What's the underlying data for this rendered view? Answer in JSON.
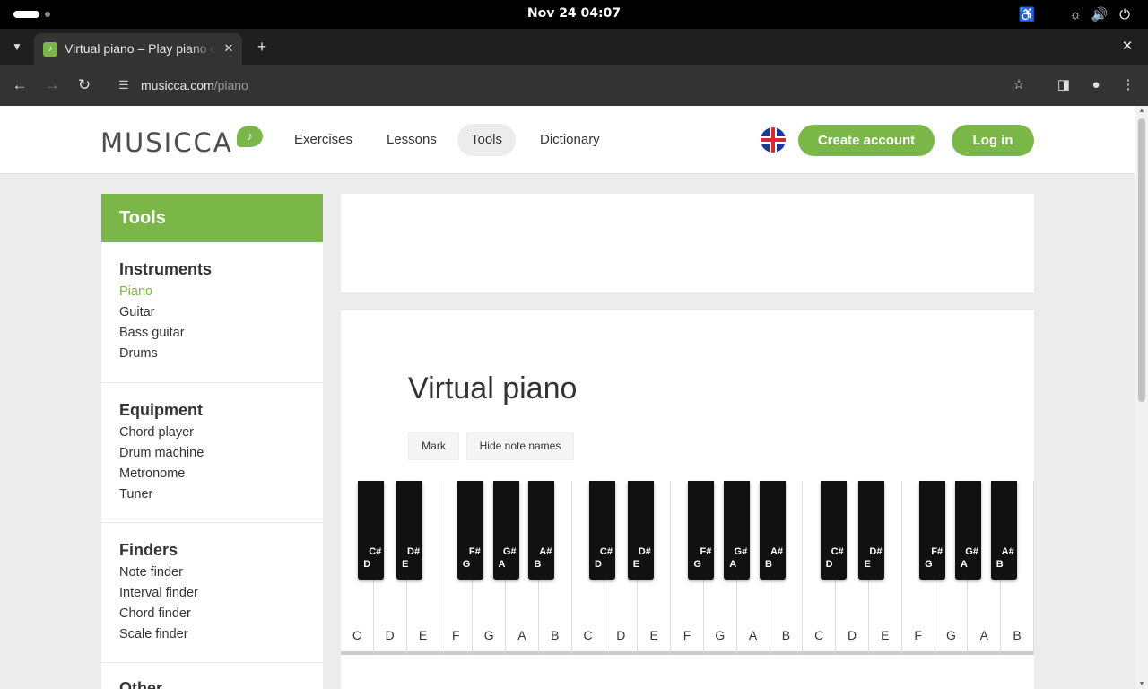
{
  "os": {
    "clock": "Nov 24  04:07"
  },
  "browser": {
    "tab_title": "Virtual piano – Play piano online",
    "url_host": "musicca.com",
    "url_path": "/piano"
  },
  "site": {
    "logo": "MUSICCA",
    "nav": [
      "Exercises",
      "Lessons",
      "Tools",
      "Dictionary"
    ],
    "active_nav": "Tools",
    "create_account": "Create account",
    "login": "Log in"
  },
  "sidebar": {
    "heading": "Tools",
    "sections": [
      {
        "title": "Instruments",
        "items": [
          "Piano",
          "Guitar",
          "Bass guitar",
          "Drums"
        ]
      },
      {
        "title": "Equipment",
        "items": [
          "Chord player",
          "Drum machine",
          "Metronome",
          "Tuner"
        ]
      },
      {
        "title": "Finders",
        "items": [
          "Note finder",
          "Interval finder",
          "Chord finder",
          "Scale finder"
        ]
      },
      {
        "title": "Other",
        "items": []
      }
    ],
    "active_item": "Piano"
  },
  "piano": {
    "title": "Virtual piano",
    "mark_label": "Mark",
    "hide_names_label": "Hide note names",
    "white_keys": [
      "C",
      "D",
      "E",
      "F",
      "G",
      "A",
      "B",
      "C",
      "D",
      "E",
      "F",
      "G",
      "A",
      "B",
      "C",
      "D",
      "E",
      "F",
      "G",
      "A",
      "B"
    ],
    "black_keys": [
      {
        "sharp": "C#",
        "natural": "D"
      },
      {
        "sharp": "D#",
        "natural": "E"
      },
      {
        "sharp": "F#",
        "natural": "G"
      },
      {
        "sharp": "G#",
        "natural": "A"
      },
      {
        "sharp": "A#",
        "natural": "B"
      },
      {
        "sharp": "C#",
        "natural": "D"
      },
      {
        "sharp": "D#",
        "natural": "E"
      },
      {
        "sharp": "F#",
        "natural": "G"
      },
      {
        "sharp": "G#",
        "natural": "A"
      },
      {
        "sharp": "A#",
        "natural": "B"
      },
      {
        "sharp": "C#",
        "natural": "D"
      },
      {
        "sharp": "D#",
        "natural": "E"
      },
      {
        "sharp": "F#",
        "natural": "G"
      },
      {
        "sharp": "G#",
        "natural": "A"
      },
      {
        "sharp": "A#",
        "natural": "B"
      }
    ]
  }
}
